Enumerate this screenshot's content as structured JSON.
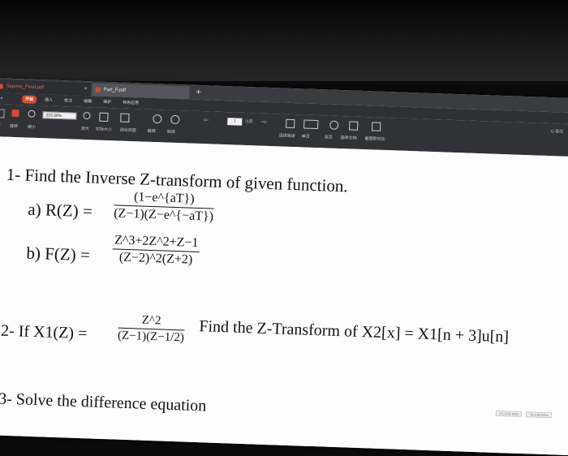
{
  "tabs": [
    {
      "label": "Sepmis_Final.pdf",
      "close": "×"
    },
    {
      "label": "Part_F.pdf"
    }
  ],
  "new_tab": "+",
  "menu": [
    "开始",
    "插入",
    "批注",
    "编辑",
    "保护",
    "特色应用"
  ],
  "toolbar": {
    "zoom": "233.38%",
    "left_group": [
      "打开",
      "旋转",
      "缩小"
    ],
    "mid_group": [
      "放大",
      "实际大小",
      "适合页面",
      "截屏",
      "阅读"
    ],
    "page_current": "1",
    "page_total": "/1页",
    "buttons": [
      "连续阅读",
      "单页",
      "双页",
      "旋转文档",
      "截图和对比"
    ],
    "search": "Q 查找"
  },
  "document": {
    "q1_title": "1- Find the Inverse Z-transform of given function.",
    "q1a_label": "a) R(Z) =",
    "q1a_num": "(1−e^{aT})",
    "q1a_den": "(Z−1)(Z−e^{−aT})",
    "q1b_label": "b) F(Z) =",
    "q1b_num": "Z^3+2Z^2+Z−1",
    "q1b_den": "(Z−2)^2(Z+2)",
    "q2_label": "2- If X1(Z) =",
    "q2_num": "Z^2",
    "q2_den": "(Z−1)(Z−1/2)",
    "q2_text": "Find the Z-Transform of X2[x] = X1[n + 3]u[n]",
    "q3_title": "3- Solve the difference equation"
  },
  "status": [
    "1/1 0.05 KB/s",
    "TB 0.00 KB/s"
  ]
}
